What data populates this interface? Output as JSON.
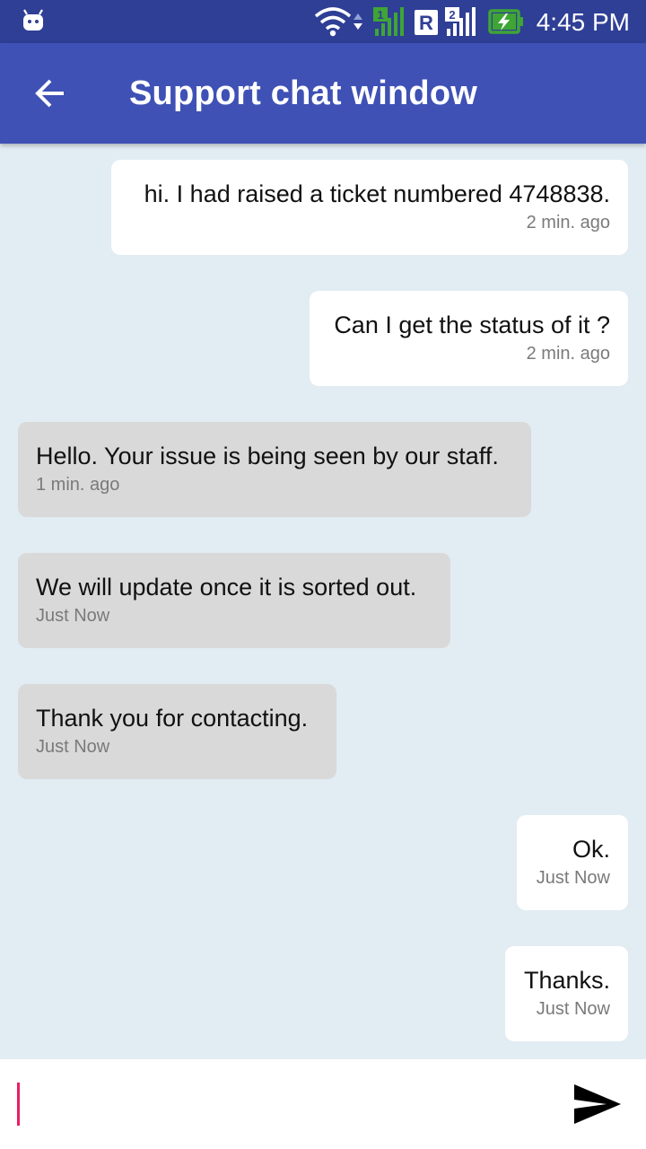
{
  "status_bar": {
    "time": "4:45 PM",
    "color": "#2f3f96",
    "icons": [
      "android-icon",
      "wifi-icon",
      "data-arrows-icon",
      "sim1-signal-icon",
      "roaming-r-icon",
      "sim2-signal-icon",
      "battery-charging-icon"
    ],
    "sim1_label": "1",
    "sim2_label": "2",
    "roaming_label": "R"
  },
  "app_bar": {
    "title": "Support chat window",
    "back_icon": "arrow-back-icon",
    "color": "#3f51b5"
  },
  "messages": [
    {
      "side": "sent",
      "text": "hi. I had raised a ticket numbered 4748838.",
      "time": "2 min. ago"
    },
    {
      "side": "sent",
      "text": "Can I get the status of it ?",
      "time": "2 min. ago"
    },
    {
      "side": "received",
      "text": "Hello. Your issue is being seen by our staff.",
      "time": "1 min. ago"
    },
    {
      "side": "received",
      "text": "We will update once it is sorted out.",
      "time": "Just Now"
    },
    {
      "side": "received",
      "text": "Thank you for contacting.",
      "time": "Just Now"
    },
    {
      "side": "sent",
      "text": "Ok.",
      "time": "Just Now"
    },
    {
      "side": "sent",
      "text": "Thanks.",
      "time": "Just Now"
    }
  ],
  "input": {
    "value": "",
    "placeholder": "",
    "cursor_color": "#e91e63",
    "send_icon": "send-icon"
  },
  "colors": {
    "background": "#e2ecf3",
    "sent_bubble": "#ffffff",
    "received_bubble": "#d9d9d9",
    "timestamp": "#7a7a7a"
  }
}
